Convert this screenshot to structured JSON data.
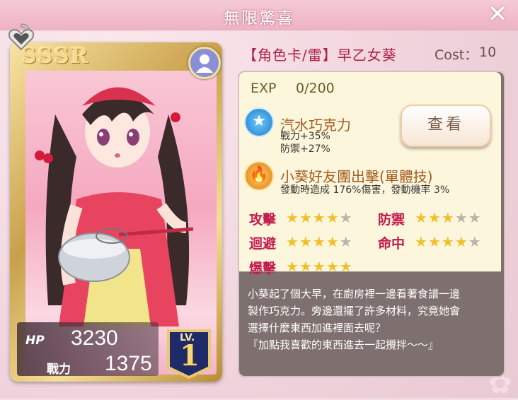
{
  "dialog": {
    "title": "無限驚喜",
    "close_label": "✕"
  },
  "card": {
    "rarity": "SSSR",
    "hp_label": "HP",
    "hp_value": "3230",
    "power_label": "戰力",
    "power_value": "1375",
    "level_label": "LV.",
    "level_value": "1"
  },
  "header": {
    "name": "【角色卡/雷】早乙女葵",
    "cost_label": "Cost：",
    "cost_value": "10"
  },
  "exp": {
    "label": "EXP",
    "value": "0/200"
  },
  "view_button": "查看",
  "skills": [
    {
      "name": "汽水巧克力",
      "lines": [
        "戰力+35%",
        "防禦+27%"
      ],
      "icon": "star-icon"
    },
    {
      "name": "小葵好友團出擊(單體技)",
      "lines": [
        "發動時造成 176%傷害，發動機率 3%"
      ],
      "icon": "fire-icon"
    }
  ],
  "attributes": [
    {
      "label": "攻擊",
      "stars": 4
    },
    {
      "label": "防禦",
      "stars": 3
    },
    {
      "label": "迴避",
      "stars": 4
    },
    {
      "label": "命中",
      "stars": 4
    },
    {
      "label": "爆擊",
      "stars": 5
    }
  ],
  "story": [
    "小葵起了個大早，在廚房裡一邊看著食譜一邊",
    "製作巧克力。旁邊還擺了許多材料，究竟她會",
    "選擇什麼東西加進裡面去呢？",
    "『加點我喜歡的東西進去一起攪拌～～』"
  ],
  "colors": {
    "accent": "#c5174b",
    "star_on": "#f0c02a",
    "star_off": "#b9b2a7"
  }
}
